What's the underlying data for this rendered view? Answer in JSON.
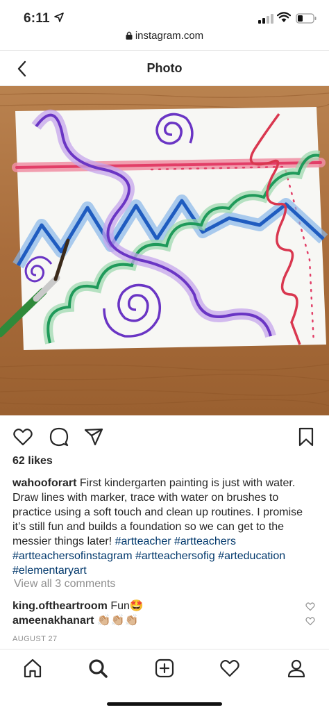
{
  "status_bar": {
    "time": "6:11"
  },
  "url_bar": {
    "url": "instagram.com"
  },
  "nav": {
    "title": "Photo"
  },
  "post": {
    "likes": "62 likes",
    "caption_user": "wahoofor­art",
    "caption_text": " First kindergarten painting is just with water. Draw lines with marker, trace with water on brushes to practice using a soft touch and clean up routines. I promise it’s still fun and builds a foundation so we can get to the messier things later! ",
    "hashtags": [
      "#artteacher",
      "#artteachers",
      "#artteachersofinstagram",
      "#artteachersofig",
      "#arteducation",
      "#elementaryart"
    ],
    "view_all": "View all 3 comments",
    "comments": [
      {
        "user": "king.oftheartroom",
        "text": " Fun🤩"
      },
      {
        "user": "ameenakhanart",
        "text": " 👏🏼👏🏼👏🏼"
      }
    ],
    "date": "AUGUST 27"
  },
  "icons": {
    "like": "heart-icon",
    "comment": "comment-bubble-icon",
    "share": "paper-plane-icon",
    "save": "bookmark-icon",
    "home": "home-icon",
    "search": "search-icon",
    "new_post": "plus-square-icon",
    "activity": "heart-icon",
    "profile": "user-icon"
  }
}
